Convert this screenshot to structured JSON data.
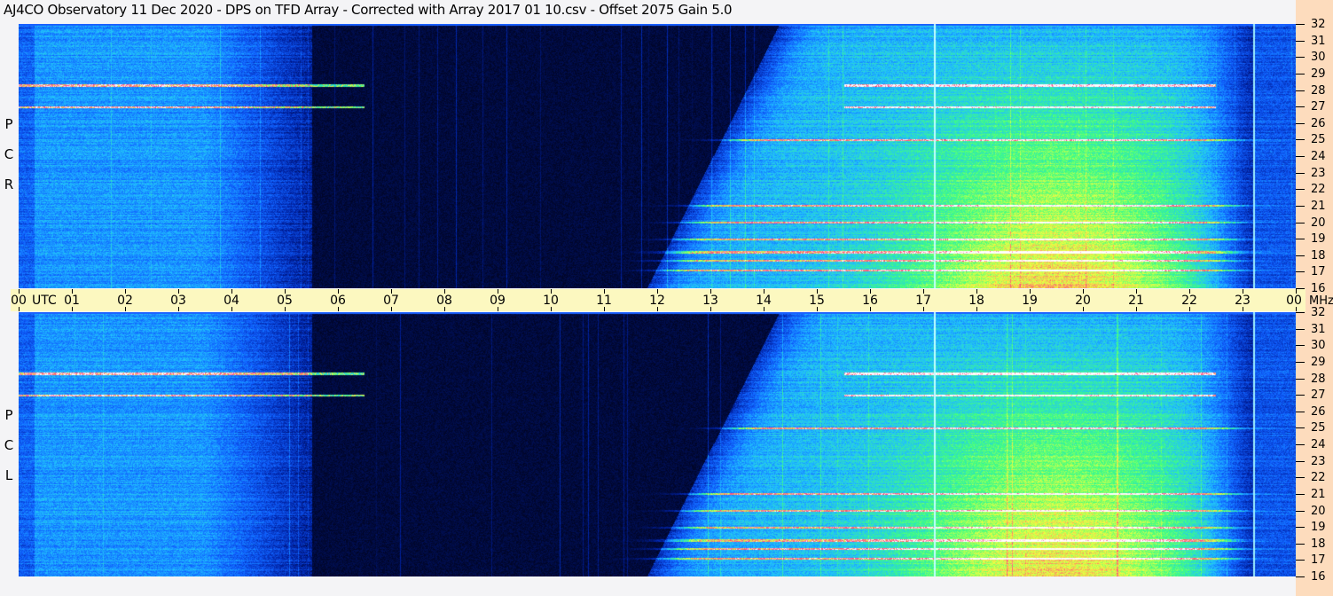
{
  "title": "AJ4CO Observatory  11 Dec 2020  -  DPS on TFD Array  -  Corrected with Array 2017 01 10.csv  -  Offset 2075  Gain 5.0",
  "chart_data": {
    "type": "heatmap",
    "title": "AJ4CO Observatory  11 Dec 2020  -  DPS on TFD Array  -  Corrected with Array 2017 01 10.csv  -  Offset 2075  Gain 5.0",
    "xlabel": "UTC",
    "ylabel": "MHz",
    "x_range": [
      0,
      24
    ],
    "y_range": [
      16,
      32
    ],
    "x_ticks": [
      "00",
      "01",
      "02",
      "03",
      "04",
      "05",
      "06",
      "07",
      "08",
      "09",
      "10",
      "11",
      "12",
      "13",
      "14",
      "15",
      "16",
      "17",
      "18",
      "19",
      "20",
      "21",
      "22",
      "23",
      "00"
    ],
    "y_ticks": [
      "32",
      "31",
      "30",
      "29",
      "28",
      "27",
      "26",
      "25",
      "24",
      "23",
      "22",
      "21",
      "20",
      "19",
      "18",
      "17",
      "16"
    ],
    "utc_label": "UTC",
    "mhz_label": "MHz",
    "panels": [
      {
        "name": "RCP",
        "letters": [
          "R",
          "C",
          "P"
        ]
      },
      {
        "name": "LCP",
        "letters": [
          "L",
          "C",
          "P"
        ]
      }
    ],
    "colormap": [
      "#000010",
      "#0020a0",
      "#1060ff",
      "#20c0ff",
      "#40ff80",
      "#f0ff40",
      "#ff4080",
      "#ffffff"
    ],
    "sunrise_utc": [
      12.0,
      14.5
    ],
    "sunset_utc": 22.8,
    "vertical_markers_utc": [
      17.2,
      23.2
    ],
    "rfi_lines_mhz": [
      27,
      17.1,
      17.7,
      18.2,
      21,
      20,
      25,
      28.3,
      19
    ]
  }
}
